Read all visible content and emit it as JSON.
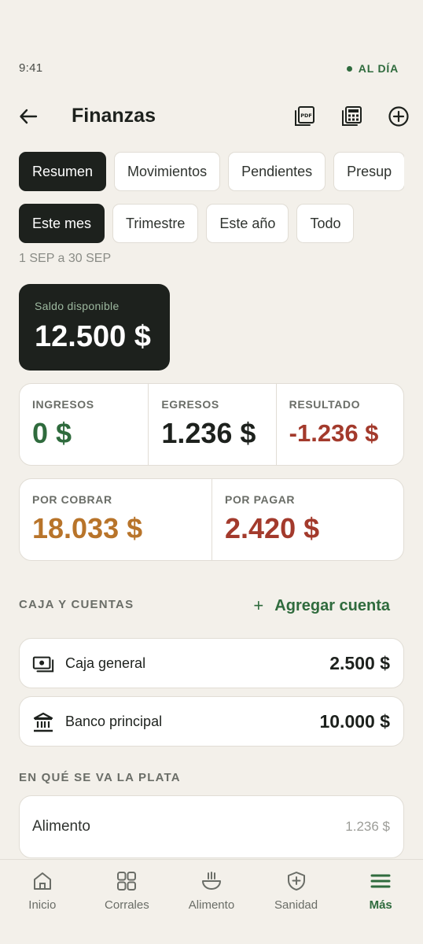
{
  "status": {
    "time": "9:41",
    "sync": "AL DÍA"
  },
  "header": {
    "title": "Finanzas",
    "icons": [
      "back-arrow-icon",
      "pdf-icon",
      "calculator-icon",
      "add-circle-icon"
    ]
  },
  "tabs": [
    {
      "label": "Resumen",
      "active": true
    },
    {
      "label": "Movimientos",
      "active": false
    },
    {
      "label": "Pendientes",
      "active": false
    },
    {
      "label": "Presup",
      "active": false
    }
  ],
  "periods": [
    {
      "label": "Este mes",
      "active": true
    },
    {
      "label": "Trimestre",
      "active": false
    },
    {
      "label": "Este año",
      "active": false
    },
    {
      "label": "Todo",
      "active": false
    }
  ],
  "date_range": "1 SEP a 30 SEP",
  "balance": {
    "label": "Saldo disponible",
    "value": "12.500 $"
  },
  "summary": {
    "ingresos": {
      "label": "INGRESOS",
      "value": "0 $",
      "color": "#2f6b3d"
    },
    "egresos": {
      "label": "EGRESOS",
      "value": "1.236 $",
      "color": "#1d211d"
    },
    "resultado": {
      "label": "RESULTADO",
      "value": "-1.236 $",
      "color": "#a33a2c"
    }
  },
  "pending": {
    "por_cobrar": {
      "label": "POR COBRAR",
      "value": "18.033 $",
      "color": "#b8742a"
    },
    "por_pagar": {
      "label": "POR PAGAR",
      "value": "2.420 $",
      "color": "#a33a2c"
    }
  },
  "accounts_section": {
    "title": "CAJA Y CUENTAS",
    "add_label": "Agregar cuenta",
    "items": [
      {
        "name": "Caja general",
        "amount": "2.500 $",
        "icon": "cash-icon"
      },
      {
        "name": "Banco principal",
        "amount": "10.000 $",
        "icon": "bank-icon"
      }
    ]
  },
  "spending_section": {
    "title": "EN QUÉ SE VA LA PLATA",
    "items": [
      {
        "name": "Alimento",
        "amount": "1.236 $"
      }
    ]
  },
  "nav": [
    {
      "label": "Inicio",
      "icon": "home-icon",
      "active": false
    },
    {
      "label": "Corrales",
      "icon": "grid-icon",
      "active": false
    },
    {
      "label": "Alimento",
      "icon": "feed-bowl-icon",
      "active": false
    },
    {
      "label": "Sanidad",
      "icon": "shield-plus-icon",
      "active": false
    },
    {
      "label": "Más",
      "icon": "menu-icon",
      "active": true
    }
  ],
  "colors": {
    "accent": "#2f6b3d",
    "dark": "#1d211d",
    "negative": "#a33a2c",
    "receivable": "#b8742a",
    "background": "#f3f0ea"
  }
}
